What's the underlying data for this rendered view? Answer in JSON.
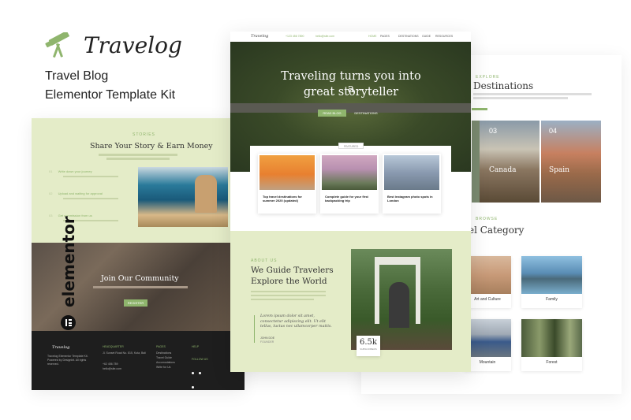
{
  "brand": {
    "name": "Travelog",
    "line1": "Travel Blog",
    "line2": "Elementor Template Kit",
    "accent": "#8fb56d",
    "icon": "telescope-icon"
  },
  "center": {
    "nav": {
      "logo": "Travelog",
      "contact1": "+123 456 7890",
      "contact2": "hello@site.com",
      "items": [
        "HOME",
        "PAGES",
        "DESTINATIONS",
        "GUIDE",
        "RESOURCES"
      ]
    },
    "hero": {
      "title_line1": "Traveling turns you into a",
      "title_line2": "great storyteller",
      "btn_primary": "READ BLOG",
      "btn_secondary": "DESTINATIONS"
    },
    "featured_label": "FEATURED",
    "posts": [
      {
        "title": "Top travel destinations for summer 2020 (updated)"
      },
      {
        "title": "Complete guide for your first backpacking trip"
      },
      {
        "title": "Best instagram photo spots in London"
      }
    ],
    "about": {
      "label": "ABOUT US",
      "title_line1": "We Guide Travelers",
      "title_line2": "Explore the World",
      "quote": "Lorem ipsum dolor sit amet, consectetur adipiscing elit. Ut elit tellus, luctus nec ullamcorper mattis.",
      "author": "JOHN DOE",
      "role": "FOUNDER",
      "stat_value": "6.5k",
      "stat_label": "SUBSCRIBERS"
    }
  },
  "left": {
    "story": {
      "label": "STORIES",
      "title": "Share Your Story & Earn Money",
      "features": [
        {
          "num": "01",
          "title": "Write down your journey"
        },
        {
          "num": "02",
          "title": "Upload and waiting for approval"
        },
        {
          "num": "03",
          "title": "Get commission from us"
        }
      ]
    },
    "community": {
      "title": "Join Our Community",
      "button": "REGISTER"
    },
    "elementor": "elementor",
    "footer": {
      "logo": "Travelog",
      "desc": "Travelog Elementor Template Kit. Powered by Designbit. All rights reserved.",
      "headquarters_label": "HEADQUARTER",
      "address": "Jl. Sunset Road No. 815, Kuta, Bali",
      "phone": "+62 456 789",
      "email": "hello@site.com",
      "pages_label": "PAGES",
      "pages": [
        "Destinations",
        "Travel Guide",
        "Accomodations",
        "Write for Us"
      ],
      "help_label": "HELP",
      "follow_label": "FOLLOW US"
    }
  },
  "right": {
    "destinations": {
      "label": "EXPLORE",
      "title": "Destinations",
      "items": [
        {
          "num": "03",
          "name": "Canada"
        },
        {
          "num": "04",
          "name": "Spain"
        }
      ]
    },
    "categories": {
      "label": "BROWSE",
      "title": "el Category",
      "items": [
        "Art and Culture",
        "Family",
        "Mountain",
        "Forest"
      ]
    }
  }
}
